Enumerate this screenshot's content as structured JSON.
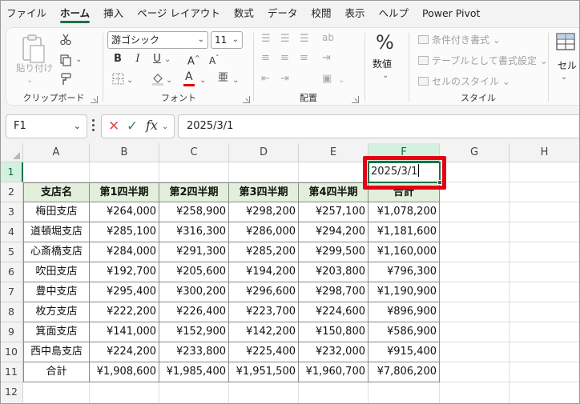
{
  "menu": {
    "tabs": [
      "ファイル",
      "ホーム",
      "挿入",
      "ページ レイアウト",
      "数式",
      "データ",
      "校閲",
      "表示",
      "ヘルプ",
      "Power Pivot"
    ],
    "active_index": 1
  },
  "ribbon": {
    "clipboard": {
      "label": "クリップボード",
      "paste_label": "貼り付け"
    },
    "font": {
      "label": "フォント",
      "font_name": "游ゴシック",
      "font_size": "11",
      "bold": "B",
      "italic": "I",
      "underline": "U"
    },
    "alignment": {
      "label": "配置"
    },
    "number": {
      "label": "数値",
      "format_symbol": "%"
    },
    "styles": {
      "label": "スタイル",
      "conditional": "条件付き書式",
      "table": "テーブルとして書式設定",
      "cell_styles": "セルのスタイル"
    },
    "cells": {
      "label": "セル"
    },
    "accent_color": "#1e7145",
    "font_color_bar": "#e00000"
  },
  "formula_bar": {
    "name_box": "F1",
    "formula": "2025/3/1"
  },
  "grid": {
    "columns": [
      "A",
      "B",
      "C",
      "D",
      "E",
      "F",
      "G",
      "H"
    ],
    "selected_column": "F",
    "rows": [
      "1",
      "2",
      "3",
      "4",
      "5",
      "6",
      "7",
      "8",
      "9",
      "10",
      "11",
      "12"
    ],
    "selected_row": "1",
    "active_cell_value": "2025/3/1",
    "header": [
      "支店名",
      "第1四半期",
      "第2四半期",
      "第3四半期",
      "第4四半期",
      "合計"
    ],
    "data": [
      [
        "梅田支店",
        "¥264,000",
        "¥258,900",
        "¥298,200",
        "¥257,100",
        "¥1,078,200"
      ],
      [
        "道頓堀支店",
        "¥285,100",
        "¥316,300",
        "¥286,000",
        "¥294,200",
        "¥1,181,600"
      ],
      [
        "心斎橋支店",
        "¥284,000",
        "¥291,300",
        "¥285,200",
        "¥299,500",
        "¥1,160,000"
      ],
      [
        "吹田支店",
        "¥192,700",
        "¥205,600",
        "¥194,200",
        "¥203,800",
        "¥796,300"
      ],
      [
        "豊中支店",
        "¥295,400",
        "¥300,200",
        "¥296,600",
        "¥298,700",
        "¥1,190,900"
      ],
      [
        "枚方支店",
        "¥222,200",
        "¥226,400",
        "¥223,700",
        "¥224,600",
        "¥896,900"
      ],
      [
        "箕面支店",
        "¥141,000",
        "¥152,900",
        "¥142,200",
        "¥150,800",
        "¥586,900"
      ],
      [
        "西中島支店",
        "¥224,200",
        "¥233,800",
        "¥225,400",
        "¥232,000",
        "¥915,400"
      ],
      [
        "合計",
        "¥1,908,600",
        "¥1,985,400",
        "¥1,951,500",
        "¥1,960,700",
        "¥7,806,200"
      ]
    ],
    "header_fill": "#e2efda",
    "highlight_color": "#e60012"
  }
}
